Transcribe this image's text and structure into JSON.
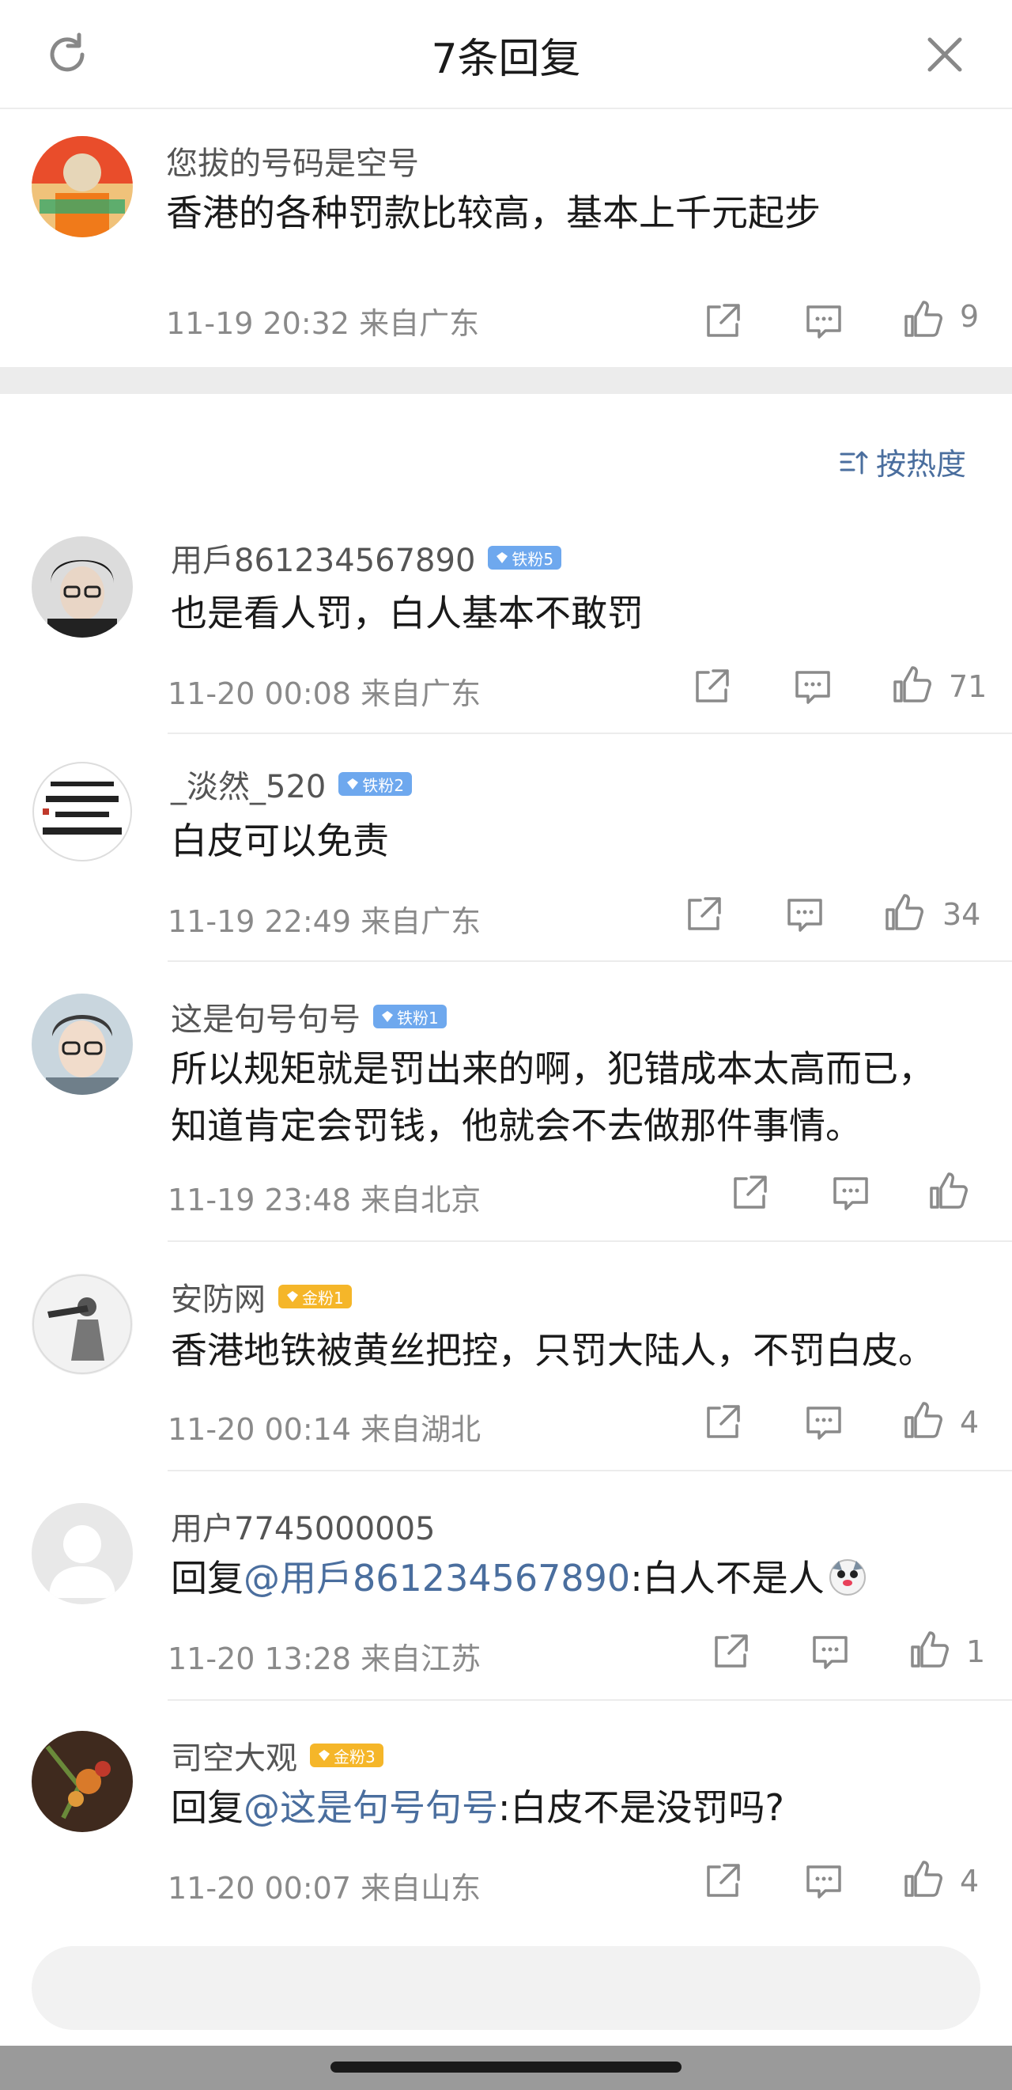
{
  "header": {
    "title": "7条回复",
    "refresh_icon": "refresh-icon",
    "close_icon": "close-icon"
  },
  "root_comment": {
    "username": "您拔的号码是空号",
    "text": "香港的各种罚款比较高，基本上千元起步",
    "time": "11-19 20:32",
    "location": "来自广东",
    "likes": "9"
  },
  "sort": {
    "label": "按热度",
    "icon": "sort-icon"
  },
  "replies": [
    {
      "username": "用戶861234567890",
      "badge": "铁粉5",
      "badge_type": "iron",
      "text": "也是看人罚，白人基本不敢罚",
      "time": "11-20 00:08",
      "location": "来自广东",
      "likes": "71"
    },
    {
      "username": "_淡然_520",
      "badge": "铁粉2",
      "badge_type": "iron",
      "text": "白皮可以免责",
      "time": "11-19 22:49",
      "location": "来自广东",
      "likes": "34"
    },
    {
      "username": "这是句号句号",
      "badge": "铁粉1",
      "badge_type": "iron",
      "text_line1": "所以规矩就是罚出来的啊，犯错成本太高而已，",
      "text_line2": "知道肯定会罚钱，他就会不去做那件事情。",
      "time": "11-19 23:48",
      "location": "来自北京",
      "likes": ""
    },
    {
      "username": "安防网",
      "badge": "金粉1",
      "badge_type": "gold",
      "text": "香港地铁被黄丝把控，只罚大陆人，不罚白皮。",
      "time": "11-20 00:14",
      "location": "来自湖北",
      "likes": "4"
    },
    {
      "username": "用户7745000005",
      "badge": "",
      "prefix": "回复",
      "mention": "@用戶861234567890",
      "text": ":白人不是人",
      "emoji": "dog-emoji",
      "time": "11-20 13:28",
      "location": "来自江苏",
      "likes": "1"
    },
    {
      "username": "司空大观",
      "badge": "金粉3",
      "badge_type": "gold",
      "prefix": "回复",
      "mention": "@这是句号句号",
      "text": ":白皮不是没罚吗?",
      "time": "11-20 00:07",
      "location": "来自山东",
      "likes": "4"
    }
  ],
  "colors": {
    "accent": "#4a6e9e",
    "iron_badge": "#6ea8ee",
    "gold_badge": "#f5b629",
    "meta": "#8a8a8a"
  }
}
